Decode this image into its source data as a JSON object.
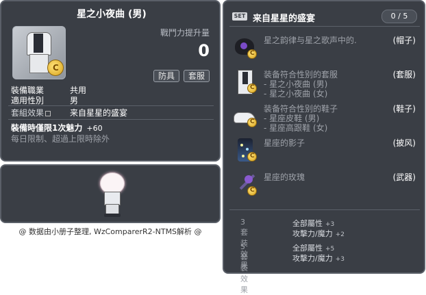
{
  "item_id": "01050444",
  "item": {
    "name": "星之小夜曲 (男)",
    "power_label": "戰鬥力提升量",
    "power_value": "0",
    "tags": [
      "防具",
      "套服"
    ],
    "job_label": "裝備職業",
    "job_value": "共用",
    "gender_label": "適用性別",
    "gender_value": "男",
    "set_effect_label": "套組效果",
    "set_effect_value": "来自星星的盛宴",
    "time_limit_label": "裝備時僅限1次魅力",
    "time_limit_value": "+60",
    "note": "每日限制、超過上限時除外"
  },
  "credit": "@ 数据由小册子整理, WzComparerR2-NTMS解析 @",
  "set": {
    "badge": "SET",
    "name": "来自星星的盛宴",
    "count": "0 / 5",
    "parts": [
      {
        "name": "星之韵律与星之歌声中的.",
        "category": "(帽子)",
        "icon": "hat-icon",
        "subs": []
      },
      {
        "name": "装备符合性别的套服",
        "category": "(套服)",
        "icon": "suit-icon",
        "subs": [
          "- 星之小夜曲 (男)",
          "- 星之小夜曲 (女)"
        ]
      },
      {
        "name": "装备符合性别的鞋子",
        "category": "(鞋子)",
        "icon": "shoe-icon",
        "subs": [
          "- 星座皮鞋 (男)",
          "- 星座高跟鞋 (女)"
        ]
      },
      {
        "name": "星座的影子",
        "category": "(披风)",
        "icon": "cape-icon",
        "subs": []
      },
      {
        "name": "星座的玫瑰",
        "category": "(武器)",
        "icon": "rose-weapon-icon",
        "subs": []
      }
    ],
    "bonuses": [
      {
        "label": "3套装效果",
        "lines": [
          {
            "text": "全部屬性",
            "value": "+3"
          },
          {
            "text": "攻擊力/魔力",
            "value": "+2"
          }
        ]
      },
      {
        "label": "5套装效果",
        "lines": [
          {
            "text": "全部屬性",
            "value": "+5"
          },
          {
            "text": "攻擊力/魔力",
            "value": "+3"
          }
        ]
      }
    ]
  }
}
